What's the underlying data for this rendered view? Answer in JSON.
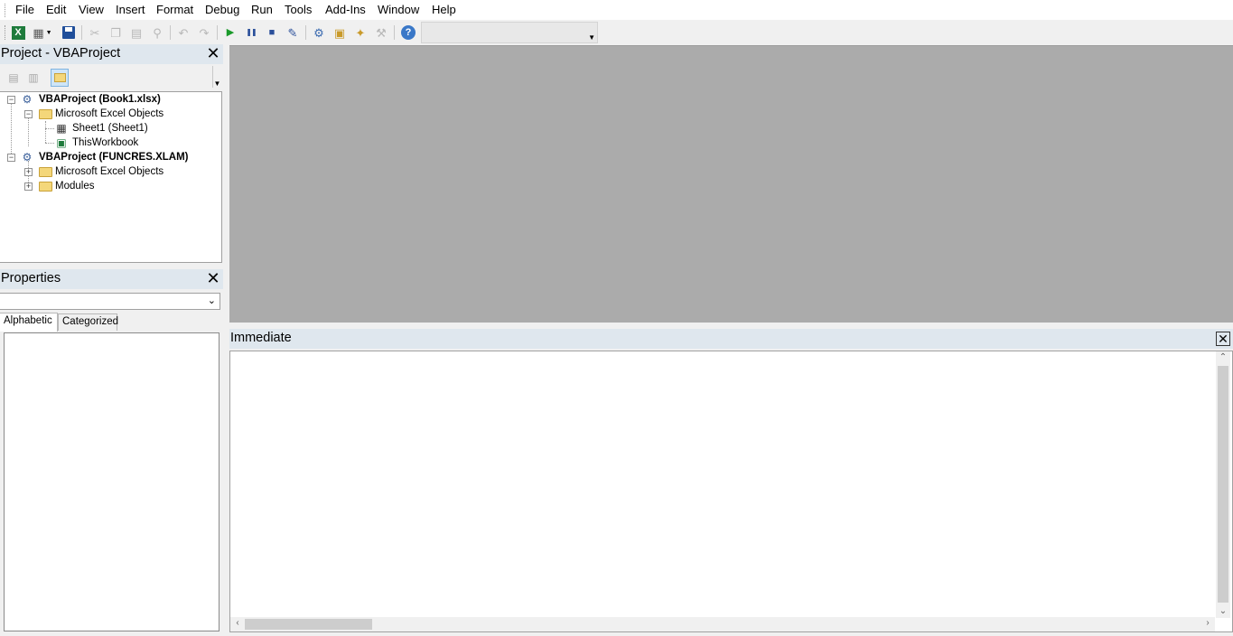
{
  "menu": [
    "File",
    "Edit",
    "View",
    "Insert",
    "Format",
    "Debug",
    "Run",
    "Tools",
    "Add-Ins",
    "Window",
    "Help"
  ],
  "toolbar": {
    "buttons": [
      {
        "name": "view-excel-icon",
        "glyph": "X",
        "color": "#1e7b3c"
      },
      {
        "name": "insert-userform-icon",
        "glyph": "▦",
        "color": "#5a5a5a"
      },
      {
        "name": "save-icon",
        "glyph": "▪",
        "color": "#1f4e9a"
      },
      {
        "name": "cut-icon",
        "glyph": "✂",
        "color": "#b8b8b8"
      },
      {
        "name": "copy-icon",
        "glyph": "❐",
        "color": "#b8b8b8"
      },
      {
        "name": "paste-icon",
        "glyph": "▤",
        "color": "#b8b8b8"
      },
      {
        "name": "find-icon",
        "glyph": "⚲",
        "color": "#b8b8b8"
      },
      {
        "name": "undo-icon",
        "glyph": "↶",
        "color": "#b8b8b8"
      },
      {
        "name": "redo-icon",
        "glyph": "↷",
        "color": "#b8b8b8"
      },
      {
        "name": "run-icon",
        "glyph": "▶",
        "color": "#1a9a2a"
      },
      {
        "name": "break-icon",
        "glyph": "❚❚",
        "color": "#2a4f9a"
      },
      {
        "name": "reset-icon",
        "glyph": "■",
        "color": "#2a4f9a"
      },
      {
        "name": "design-mode-icon",
        "glyph": "✎",
        "color": "#2a4f9a"
      },
      {
        "name": "project-explorer-icon",
        "glyph": "⚙",
        "color": "#3a6ab0"
      },
      {
        "name": "properties-window-icon",
        "glyph": "▣",
        "color": "#c99a2a"
      },
      {
        "name": "object-browser-icon",
        "glyph": "✦",
        "color": "#c99a2a"
      },
      {
        "name": "toolbox-icon",
        "glyph": "⚒",
        "color": "#a8a8a8"
      },
      {
        "name": "help-icon",
        "glyph": "?",
        "color": "#ffffff"
      }
    ]
  },
  "project_pane": {
    "title": "Project - VBAProject",
    "tree": {
      "project1": "VBAProject (Book1.xlsx)",
      "excel_objects1": "Microsoft Excel Objects",
      "sheet1": "Sheet1 (Sheet1)",
      "thisworkbook": "ThisWorkbook",
      "project2": "VBAProject (FUNCRES.XLAM)",
      "excel_objects2": "Microsoft Excel Objects",
      "modules": "Modules"
    }
  },
  "properties_pane": {
    "title": "Properties",
    "tabs": [
      "Alphabetic",
      "Categorized"
    ]
  },
  "immediate_pane": {
    "title": "Immediate"
  },
  "colors": {
    "pane_title_bg": "#dfe7ee",
    "mdi_bg": "#ababab",
    "folder": "#f4d77a"
  }
}
